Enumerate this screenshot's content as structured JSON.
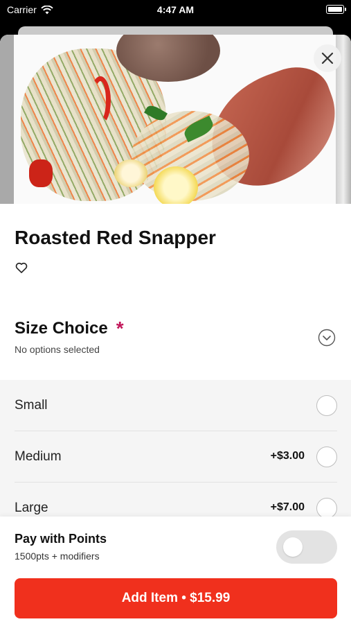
{
  "status_bar": {
    "carrier": "Carrier",
    "time": "4:47 AM"
  },
  "item": {
    "title": "Roasted Red Snapper"
  },
  "size_choice": {
    "title": "Size Choice",
    "required_marker": "*",
    "subtitle": "No options selected",
    "options": [
      {
        "label": "Small",
        "price": ""
      },
      {
        "label": "Medium",
        "price": "+$3.00"
      },
      {
        "label": "Large",
        "price": "+$7.00"
      }
    ]
  },
  "points": {
    "title": "Pay with Points",
    "subtitle": "1500pts + modifiers",
    "enabled": false
  },
  "add_button": {
    "label": "Add Item • $15.99"
  },
  "colors": {
    "accent": "#f0301d",
    "required": "#c2185b"
  },
  "icons": [
    "wifi-icon",
    "battery-icon",
    "close-icon",
    "heart-icon",
    "chevron-down-icon"
  ]
}
